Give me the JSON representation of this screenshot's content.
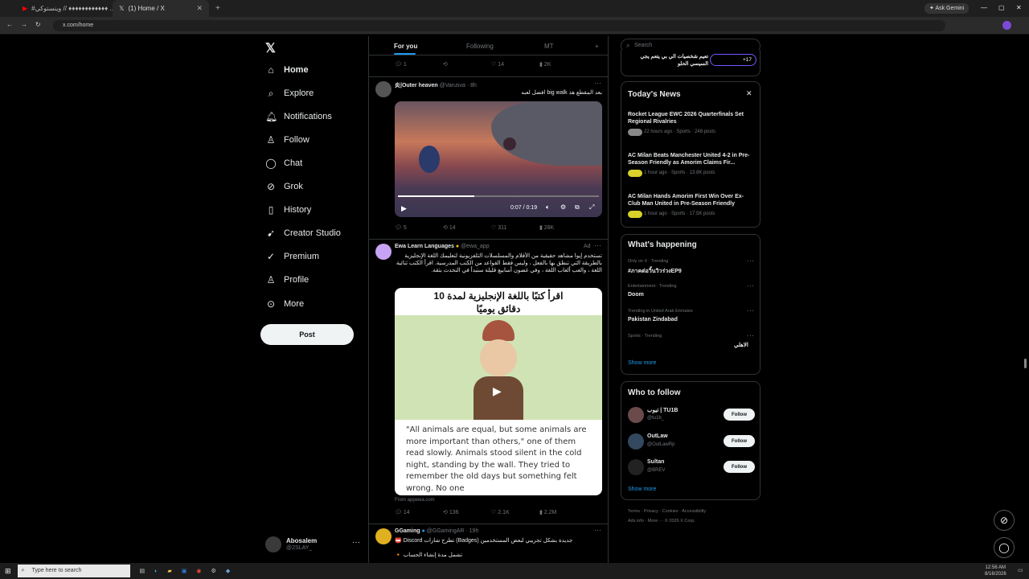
{
  "browser": {
    "tab1": "#وينستوكي // ♦♦♦♦♦♦♦♦♦♦♦♦ ...",
    "tab2": "(1) Home / X",
    "url": "x.com/home",
    "gemini": "Ask Gemini"
  },
  "nav": {
    "items": [
      "Home",
      "Explore",
      "Notifications",
      "Follow",
      "Chat",
      "Grok",
      "History",
      "Creator Studio",
      "Premium",
      "Profile",
      "More"
    ],
    "post": "Post",
    "user_name": "Abosalem",
    "user_handle": "@2SLAY_"
  },
  "feed": {
    "tabs": [
      "For you",
      "Following",
      "MT"
    ],
    "top_actions": {
      "replies": "1",
      "likes": "14",
      "views": "2K"
    },
    "t1": {
      "name": "炎|Outer heaven",
      "handle": "@Varusva · 8h",
      "text": "بعد المقطع هذ big walk افضل لعبه",
      "video_time": "0:07 / 0:19",
      "replies": "5",
      "reposts": "14",
      "likes": "311",
      "views": "28K"
    },
    "t2": {
      "name": "Ewa Learn Languages",
      "handle": "@ewa_app",
      "ad": "Ad",
      "text": "تستخدم إيوا مشاهد حقيقية من الأفلام والمسلسلات التلفزيونية لتعليمك اللغة الإنجليزية بالطريقة التي تنطق بها بالفعل ، وليس فقط القواعد من الكتب المدرسية. اقرأ الكتب ثنائية اللغة ، والعب ألعاب اللغة ، وفي غضون أسابيع قليلة ستبدأ في التحدث بثقة.",
      "img_title": "اقرأ كتبًا باللغة الإنجليزية لمدة 10 دقائق يوميًا",
      "img_text": "\"All animals are equal, but some animals are more important than others,\" one of them read slowly. Animals stood silent in the cold night, standing by the wall. They tried to remember the old days but something felt wrong. No one",
      "from": "From appewa.com",
      "replies": "14",
      "reposts": "136",
      "likes": "2.1K",
      "views": "2.2M"
    },
    "t3": {
      "name": "GGaming",
      "handle": "@GGamingAR · 19h",
      "text": "جديدة بشكل تجريبي لبعض المستخدمين (Badges) تطرح شارات Discord 📛",
      "text2": "تشمل مدة إنشاء الحساب 🔸"
    }
  },
  "sidebar": {
    "search_placeholder": "Search",
    "top_banner": "تعيم شخصيات الي بي يتعم يجي السيسي الحلو",
    "top_count": "+17",
    "news_title": "Today's News",
    "news": [
      {
        "title": "Rocket League EWC 2026 Quarterfinals Set Regional Rivalries",
        "meta": "22 hours ago · Sports · 248 posts"
      },
      {
        "title": "AC Milan Beats Manchester United 4-2 in Pre-Season Friendly as Amorim Claims Fir...",
        "meta": "1 hour ago · Sports · 13.8K posts"
      },
      {
        "title": "AC Milan Hands Amorim First Win Over Ex-Club Man United in Pre-Season Friendly",
        "meta": "1 hour ago · Sports · 17.5K posts"
      }
    ],
    "happening_title": "What's happening",
    "trends": [
      {
        "cat": "Only on X · Trending",
        "name": "#ภาคต่อวิ้นวิวร่วงEP9"
      },
      {
        "cat": "Entertainment · Trending",
        "name": "Doom"
      },
      {
        "cat": "Trending in United Arab Emirates",
        "name": "Pakistan Zindabad"
      },
      {
        "cat": "Sports · Trending",
        "name": "الاهلي"
      }
    ],
    "show_more": "Show more",
    "who_title": "Who to follow",
    "who": [
      {
        "name": "تيوب | TU1B",
        "handle": "@tu1b_"
      },
      {
        "name": "OutLaw",
        "handle": "@OutLawRp"
      },
      {
        "name": "Sultan",
        "handle": "@BREV"
      }
    ],
    "follow_label": "Follow",
    "footer1": "Terms · Privacy · Cookies · Accessibility",
    "footer2": "Ads info · More ··· © 2026 X Corp."
  },
  "taskbar": {
    "search": "Type here to search",
    "time": "12:56 AM",
    "date": "8/16/2026"
  }
}
